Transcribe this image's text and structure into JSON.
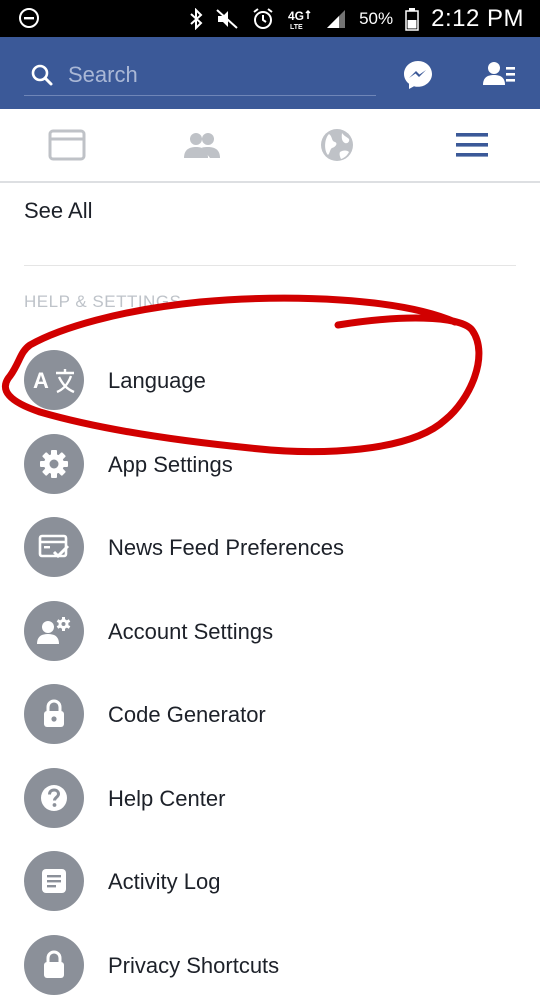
{
  "status_bar": {
    "battery": "50%",
    "time": "2:12 PM",
    "network": "4G LTE",
    "icons": [
      "do-not-disturb-icon",
      "bluetooth-icon",
      "mute-icon",
      "alarm-icon",
      "network-4g-lte-icon",
      "signal-icon",
      "battery-icon"
    ]
  },
  "header": {
    "search_placeholder": "Search",
    "color": "#3b5998"
  },
  "tabs": [
    "news-feed-tab",
    "friends-tab",
    "notifications-globe-tab",
    "menu-tab"
  ],
  "active_tab": "menu-tab",
  "content": {
    "see_all": "See All",
    "section_title": "HELP & SETTINGS",
    "items": [
      {
        "label": "Language",
        "icon": "translate-icon"
      },
      {
        "label": "App Settings",
        "icon": "gear-icon"
      },
      {
        "label": "News Feed Preferences",
        "icon": "news-feed-prefs-icon"
      },
      {
        "label": "Account Settings",
        "icon": "account-settings-icon"
      },
      {
        "label": "Code Generator",
        "icon": "lock-icon"
      },
      {
        "label": "Help Center",
        "icon": "question-icon"
      },
      {
        "label": "Activity Log",
        "icon": "activity-log-icon"
      },
      {
        "label": "Privacy Shortcuts",
        "icon": "privacy-lock-icon"
      }
    ]
  },
  "annotation_color": "#d10000"
}
